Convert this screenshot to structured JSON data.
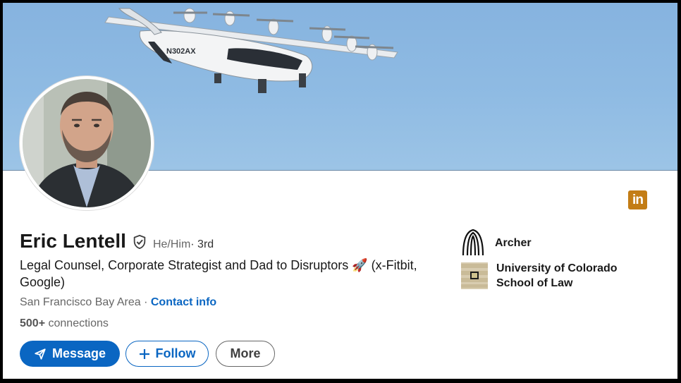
{
  "profile": {
    "name": "Eric Lentell",
    "pronouns": "He/Him",
    "degree": " · 3rd",
    "headline": "Legal Counsel, Corporate Strategist and Dad to Disruptors 🚀 (x-Fitbit, Google)",
    "location": "San Francisco Bay Area",
    "location_sep": " · ",
    "contact_label": "Contact info",
    "connections_count": "500+",
    "connections_label": " connections"
  },
  "cover": {
    "aircraft_tail": "N302AX"
  },
  "actions": {
    "message_label": "Message",
    "follow_label": "Follow",
    "more_label": "More"
  },
  "experience": {
    "company": "Archer",
    "school_line1": "University of Colorado",
    "school_line2": "School of Law"
  },
  "colors": {
    "primary": "#0a66c2",
    "linkedin_badge": "#c37d16",
    "sky": "#8fbbe3"
  },
  "icons": [
    "verified-shield-icon",
    "linkedin-icon",
    "send-icon",
    "plus-icon",
    "archer-logo-icon"
  ]
}
